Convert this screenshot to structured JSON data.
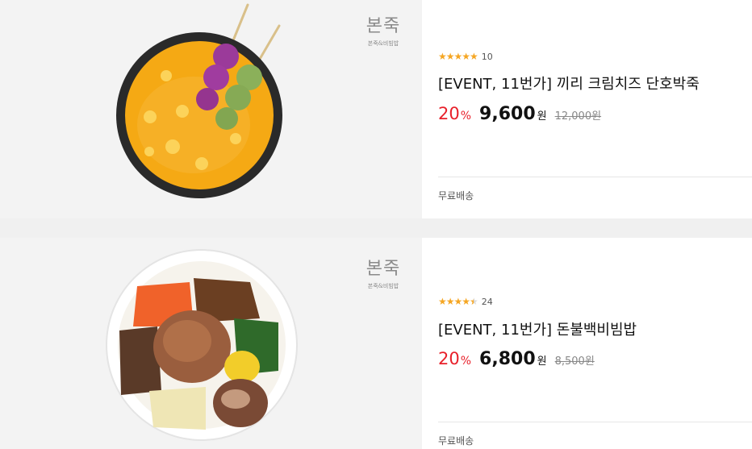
{
  "products": [
    {
      "brand_main": "본죽",
      "brand_sub": "본죽&비빔밥",
      "image_icon": "pumpkin-porridge-image",
      "stars": "★★★★★",
      "rating": 5,
      "review_count": "10",
      "title": "[EVENT, 11번가] 끼리 크림치즈 단호박죽",
      "discount": "20",
      "discount_unit": "%",
      "price": "9,600",
      "price_unit": "원",
      "original_price": "12,000원",
      "shipping": "무료배송"
    },
    {
      "brand_main": "본죽",
      "brand_sub": "본죽&비빔밥",
      "image_icon": "bibimbap-image",
      "stars": "★★★★★",
      "rating": 4.5,
      "review_count": "24",
      "title": "[EVENT, 11번가] 돈불백비빔밥",
      "discount": "20",
      "discount_unit": "%",
      "price": "6,800",
      "price_unit": "원",
      "original_price": "8,500원",
      "shipping": "무료배송"
    }
  ],
  "colors": {
    "discount": "#e8202a",
    "star": "#f5a623",
    "thumb_bg": "#f3f3f3"
  }
}
